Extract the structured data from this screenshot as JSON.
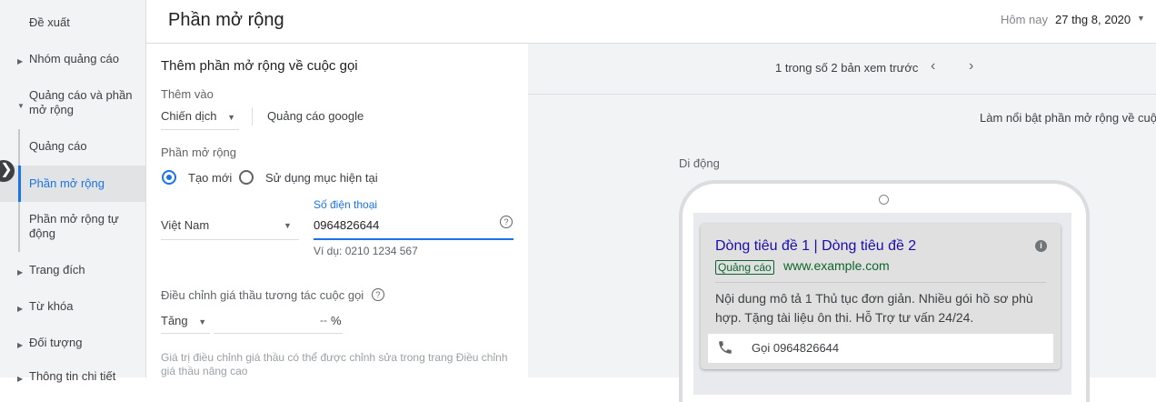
{
  "sidebar": {
    "items": [
      {
        "label": "Đề xuất"
      },
      {
        "label": "Nhóm quảng cáo"
      },
      {
        "label": "Quảng cáo và phần mở rộng"
      },
      {
        "label": "Quảng cáo"
      },
      {
        "label": "Phần mở rộng"
      },
      {
        "label": "Phần mở rộng tự động"
      },
      {
        "label": "Trang đích"
      },
      {
        "label": "Từ khóa"
      },
      {
        "label": "Đối tượng"
      },
      {
        "label": "Thông tin chi tiết"
      }
    ]
  },
  "header": {
    "title": "Phần mở rộng",
    "date_label": "Hôm nay",
    "date_value": "27 thg 8, 2020"
  },
  "form": {
    "heading": "Thêm phần mở rộng về cuộc gọi",
    "add_to_label": "Thêm vào",
    "level_value": "Chiến dịch",
    "campaign_name": "Quảng cáo google",
    "extension_label": "Phần mở rộng",
    "radio_new": "Tạo mới",
    "radio_existing": "Sử dụng mục hiện tại",
    "country_value": "Việt Nam",
    "phone_label": "Số điện thoại",
    "phone_value": "0964826644",
    "phone_example": "Ví dụ: 0210 1234 567",
    "bid_adjust_label": "Điều chỉnh giá thầu tương tác cuộc gọi",
    "bid_direction": "Tăng",
    "bid_value": "--",
    "bid_unit": "%",
    "bid_note": "Giá trị điều chỉnh giá thầu có thể được chỉnh sửa trong trang Điều chỉnh giá thầu nâng cao"
  },
  "preview": {
    "counter": "1 trong số 2 bản xem trước",
    "highlight_note": "Làm nổi bật phần mở rộng về cuộc",
    "device_label": "Di động",
    "ad": {
      "title": "Dòng tiêu đề 1 | Dòng tiêu đề 2",
      "badge": "Quảng cáo",
      "url": "www.example.com",
      "description": "Nội dung mô tả 1 Thủ tục đơn giản. Nhiều gói hồ sơ phù hợp. Tặng tài liệu ôn thi. Hỗ Trợ tư vấn 24/24.",
      "call_text": "Gọi 0964826644"
    }
  },
  "colors": {
    "accent": "#1a73e8",
    "ad_title": "#1a0dab",
    "ad_url": "#0d652d"
  }
}
